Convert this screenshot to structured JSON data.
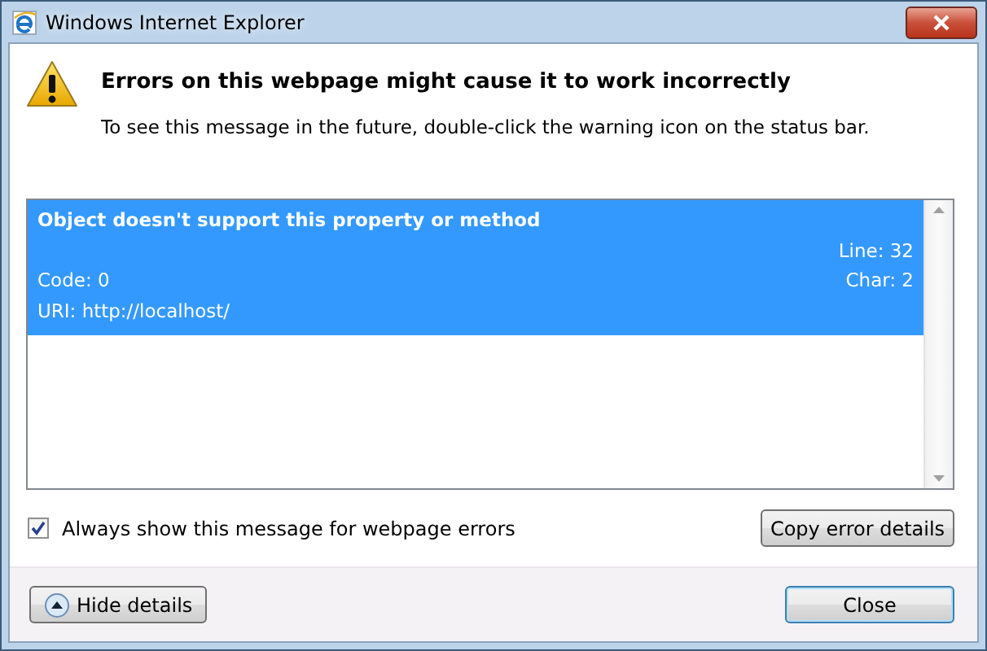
{
  "window": {
    "title": "Windows Internet Explorer"
  },
  "heading": "Errors on this webpage might cause it to work incorrectly",
  "hint": "To see this message in the future, double-click the warning icon on the status bar.",
  "errors": [
    {
      "message": "Object doesn't support this property or method",
      "line": "Line: 32",
      "char": "Char: 2",
      "code": "Code: 0",
      "uri": "URI: http://localhost/",
      "selected": true
    }
  ],
  "always_show": {
    "label": "Always show this message for webpage errors",
    "checked": true
  },
  "buttons": {
    "copy": "Copy error details",
    "hide_details": "Hide details",
    "close": "Close"
  }
}
